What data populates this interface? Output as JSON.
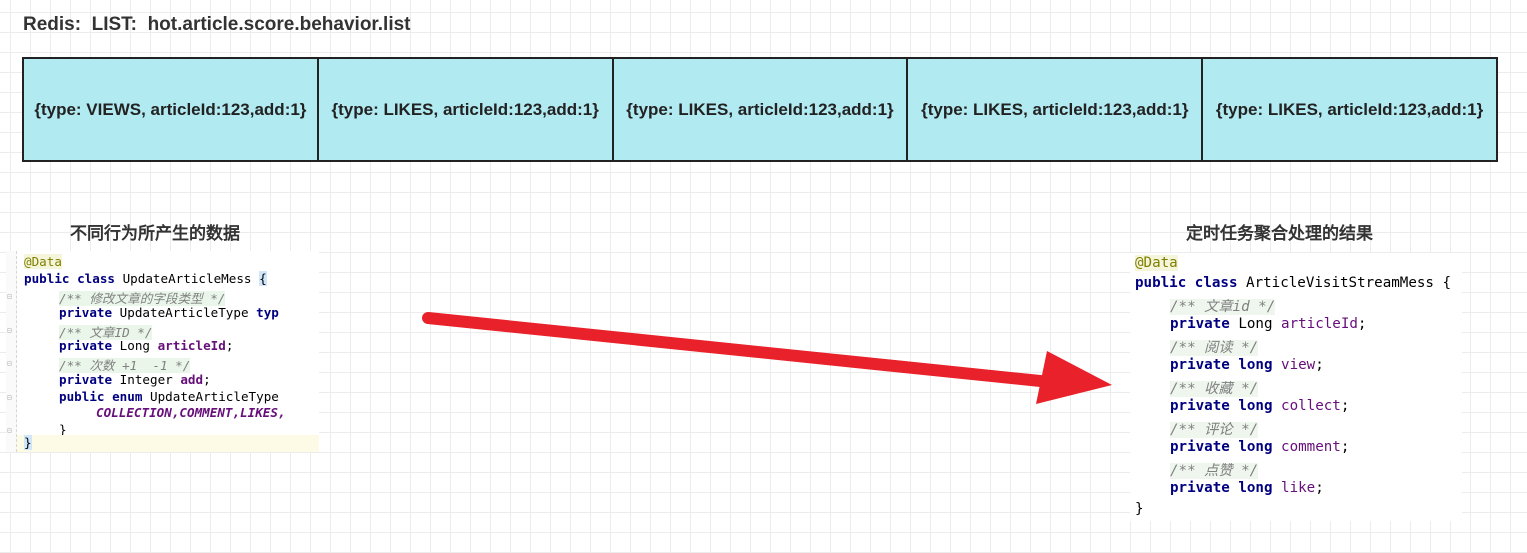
{
  "title": "Redis:  LIST:  hot.article.score.behavior.list",
  "list_items": [
    "{type: VIEWS, articleId:123,add:1}",
    "{type: LIKES, articleId:123,add:1}",
    " {type: LIKES, articleId:123,add:1}",
    "{type: LIKES, articleId:123,add:1}",
    "{type: LIKES, articleId:123,add:1}"
  ],
  "left_caption": "不同行为所产生的数据",
  "right_caption": "定时任务聚合处理的结果",
  "left_code": {
    "annotation": "@Data",
    "class_decl_kw": "public class",
    "class_name": " UpdateArticleMess ",
    "open_brace": "{",
    "c1": "/** 修改文章的字段类型 */",
    "l_type_kw": "private",
    "l_type_rest": " UpdateArticleType ",
    "l_type_tail": "typ",
    "c2": "/** 文章ID */",
    "l_id_kw": "private",
    "l_id_type": " Long ",
    "l_id_name": "articleId",
    "c3": "/** 次数 +1  -1 */",
    "l_add_kw": "private",
    "l_add_type": " Integer ",
    "l_add_name": "add",
    "l_enum_kw": "public enum",
    "l_enum_name": " UpdateArticleType",
    "enum_values": "COLLECTION,COMMENT,LIKES,",
    "inner_close": "}",
    "outer_close": "}"
  },
  "right_code": {
    "annotation": "@Data",
    "class_decl_kw": "public class",
    "class_name": " ArticleVisitStreamMess {",
    "c1": "/** 文章id */",
    "f1_kw": "private",
    "f1_type": " Long ",
    "f1_name": "articleId",
    "c2": "/** 阅读 */",
    "f2_kw": "private long",
    "f2_name": "view",
    "c3": "/** 收藏 */",
    "f3_kw": "private long",
    "f3_name": "collect",
    "c4": "/** 评论 */",
    "f4_kw": "private long",
    "f4_name": "comment",
    "c5": "/** 点赞 */",
    "f5_kw": "private long",
    "f5_name": "like",
    "close": "}"
  },
  "colors": {
    "cell_fill": "#b1eaf1",
    "arrow": "#e8212a"
  }
}
